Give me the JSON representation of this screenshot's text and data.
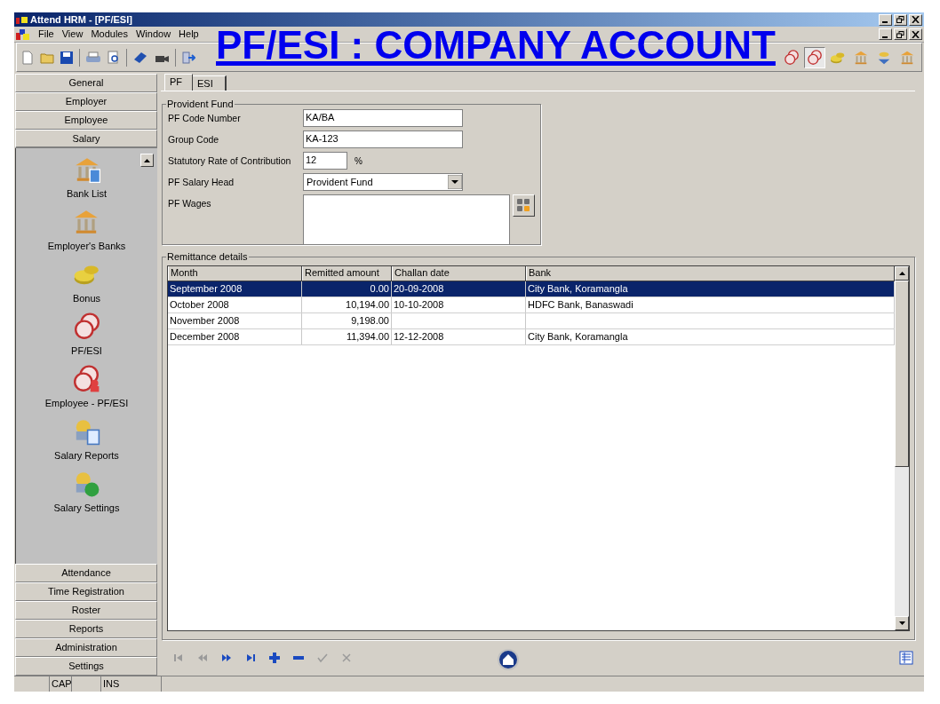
{
  "window": {
    "title": "Attend HRM - [PF/ESI]"
  },
  "menu": [
    "File",
    "View",
    "Modules",
    "Window",
    "Help"
  ],
  "heading": "PF/ESI : COMPANY ACCOUNT",
  "toolbar_right": [
    {
      "kind": "stamp",
      "selected": false
    },
    {
      "kind": "stamp",
      "selected": true
    },
    {
      "kind": "coins",
      "selected": false
    },
    {
      "kind": "bank",
      "selected": false
    },
    {
      "kind": "swap",
      "selected": false
    },
    {
      "kind": "bank",
      "selected": false
    }
  ],
  "sidebar": {
    "sections": [
      {
        "label": "General",
        "expanded": false
      },
      {
        "label": "Employer",
        "expanded": false
      },
      {
        "label": "Employee",
        "expanded": false
      },
      {
        "label": "Salary",
        "expanded": true,
        "items": [
          {
            "label": "Bank List",
            "kind": "bank-list"
          },
          {
            "label": "Employer's Banks",
            "kind": "bank"
          },
          {
            "label": "Bonus",
            "kind": "coins"
          },
          {
            "label": "PF/ESI",
            "kind": "stamp"
          },
          {
            "label": "Employee - PF/ESI",
            "kind": "stamp-person"
          },
          {
            "label": "Salary Reports",
            "kind": "report"
          },
          {
            "label": "Salary Settings",
            "kind": "settings"
          }
        ]
      },
      {
        "label": "Attendance",
        "expanded": false
      },
      {
        "label": "Time Registration",
        "expanded": false
      },
      {
        "label": "Roster",
        "expanded": false
      },
      {
        "label": "Reports",
        "expanded": false
      },
      {
        "label": "Administration",
        "expanded": false
      },
      {
        "label": "Settings",
        "expanded": false
      }
    ]
  },
  "tabs": [
    {
      "label": "PF",
      "selected": true
    },
    {
      "label": "ESI",
      "selected": false
    }
  ],
  "provident_fund": {
    "title": "Provident Fund",
    "fields": [
      {
        "label": "PF Code Number",
        "kind": "text",
        "value": "KA/BA"
      },
      {
        "label": "Group Code",
        "kind": "text",
        "value": "KA-123"
      },
      {
        "label": "Statutory Rate of Contribution",
        "kind": "percent",
        "value": "12",
        "unit": "%"
      },
      {
        "label": "PF Salary Head",
        "kind": "dropdown",
        "value": "Provident Fund"
      },
      {
        "label": "PF Wages",
        "kind": "memo"
      }
    ]
  },
  "remittance": {
    "title": "Remittance details",
    "columns": [
      "Month",
      "Remitted amount",
      "Challan date",
      "Bank"
    ],
    "rows": [
      {
        "cells": [
          "September 2008",
          "0.00",
          "20-09-2008",
          "City Bank, Koramangla"
        ],
        "selected": true
      },
      {
        "cells": [
          "October 2008",
          "10,194.00",
          "10-10-2008",
          "HDFC Bank, Banaswadi"
        ],
        "selected": false
      },
      {
        "cells": [
          "November 2008",
          "9,198.00",
          "",
          ""
        ],
        "selected": false
      },
      {
        "cells": [
          "December 2008",
          "11,394.00",
          "12-12-2008",
          "City Bank, Koramangla"
        ],
        "selected": false
      }
    ]
  },
  "nav_buttons": [
    {
      "kind": "first",
      "disabled": true
    },
    {
      "kind": "prev",
      "disabled": true
    },
    {
      "kind": "next",
      "disabled": false
    },
    {
      "kind": "last",
      "disabled": false
    },
    {
      "kind": "add",
      "disabled": false
    },
    {
      "kind": "remove",
      "disabled": false
    },
    {
      "kind": "confirm",
      "disabled": true
    },
    {
      "kind": "cancel",
      "disabled": true
    }
  ],
  "status_bar": [
    "CAP",
    "INS"
  ]
}
